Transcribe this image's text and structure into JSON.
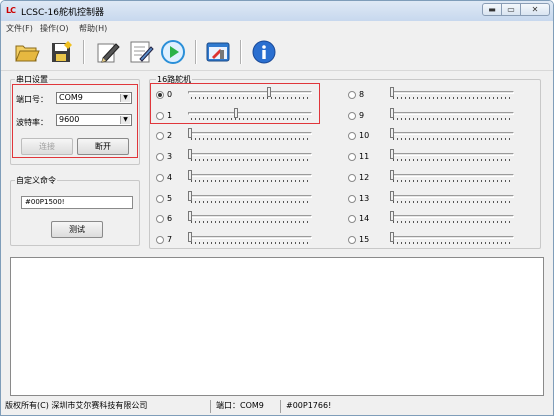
{
  "window": {
    "app_icon_text": "LC",
    "title": "LCSC-16舵机控制器",
    "controls": {
      "minimize": "▬",
      "maximize": "▭",
      "close": "✕"
    }
  },
  "menu": [
    "文件(F)",
    "操作(O)",
    "帮助(H)"
  ],
  "toolbar": {
    "buttons": [
      {
        "name": "open-folder-icon"
      },
      {
        "name": "save-file-icon"
      },
      {
        "name": "edit-pen-icon"
      },
      {
        "name": "edit-document-icon"
      },
      {
        "name": "play-icon"
      },
      {
        "name": "tools-icon"
      },
      {
        "name": "info-icon"
      }
    ],
    "colors": {
      "play": "#2a8fd8",
      "info": "#2a6fd0",
      "folder": "#e6b840"
    }
  },
  "serial": {
    "legend": "串口设置",
    "port_label": "端口号：",
    "port_value": "COM9",
    "baud_label": "波特率：",
    "baud_value": "9600",
    "connect_label": "连接",
    "disconnect_label": "断开"
  },
  "custom": {
    "legend": "自定义命令",
    "command_value": "#00P1500!",
    "test_label": "测试"
  },
  "servos": {
    "legend": "16路舵机",
    "selected_channel": "0",
    "channels": [
      {
        "id": "0",
        "level": 0.66
      },
      {
        "id": "1",
        "level": 0.38
      },
      {
        "id": "2",
        "level": 0.0
      },
      {
        "id": "3",
        "level": 0.0
      },
      {
        "id": "4",
        "level": 0.0
      },
      {
        "id": "5",
        "level": 0.0
      },
      {
        "id": "6",
        "level": 0.0
      },
      {
        "id": "7",
        "level": 0.0
      },
      {
        "id": "8",
        "level": 0.0
      },
      {
        "id": "9",
        "level": 0.0
      },
      {
        "id": "10",
        "level": 0.0
      },
      {
        "id": "11",
        "level": 0.0
      },
      {
        "id": "12",
        "level": 0.0
      },
      {
        "id": "13",
        "level": 0.0
      },
      {
        "id": "14",
        "level": 0.0
      },
      {
        "id": "15",
        "level": 0.0
      }
    ]
  },
  "log": {
    "text": ""
  },
  "status": {
    "copyright": "版权所有(C) 深圳市艾尔赛科技有限公司",
    "port": "端口：COM9",
    "last_command": "#00P1766!"
  },
  "colors": {
    "highlight_box": "#e0363b"
  }
}
